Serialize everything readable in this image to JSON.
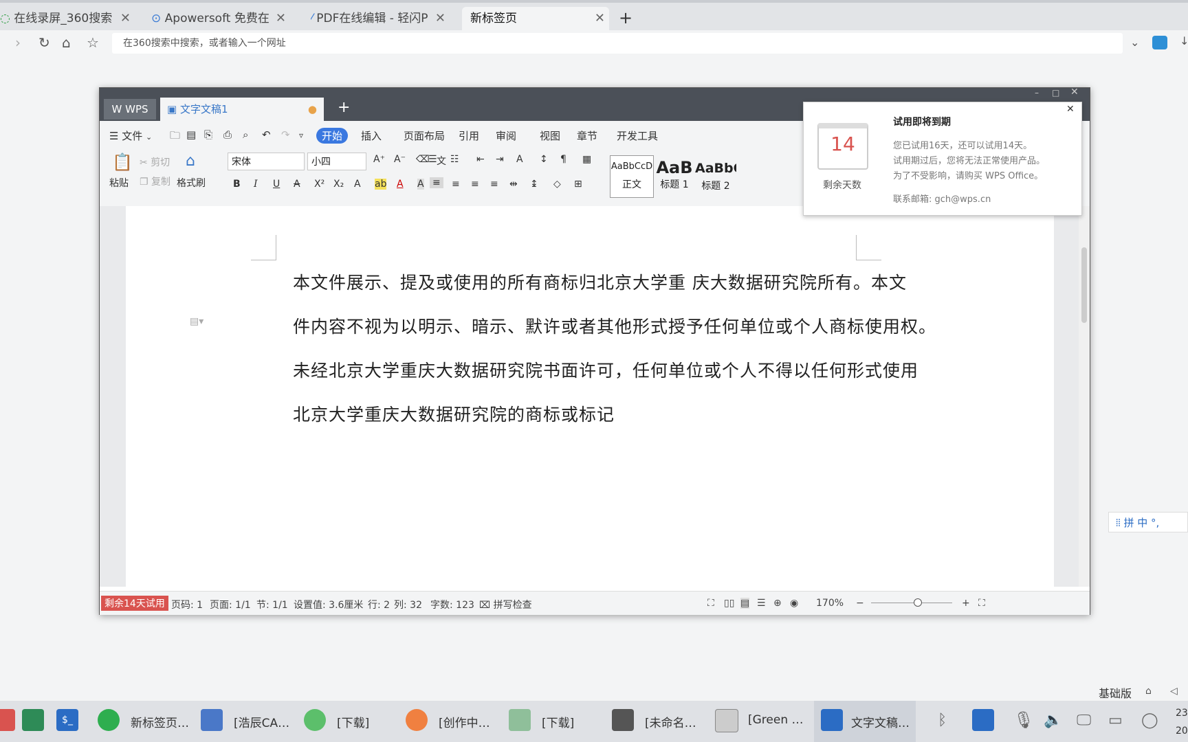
{
  "browser": {
    "tabs": [
      {
        "label": "在线录屏_360搜索"
      },
      {
        "label": "Apowersoft 免费在"
      },
      {
        "label": "PDF在线编辑 - 轻闪P"
      },
      {
        "label": "新标签页"
      }
    ],
    "new_tab": "+",
    "address_placeholder": "在360搜索中搜索，或者输入一个网址"
  },
  "wps": {
    "tab_wps": "WPS",
    "tab_doc": "文字文稿1",
    "add_tab": "+",
    "menu": {
      "file": "文件",
      "items": [
        "开始",
        "插入",
        "页面布局",
        "引用",
        "审阅",
        "视图",
        "章节",
        "开发工具"
      ]
    },
    "ribbon": {
      "paste": "粘贴",
      "cut": "剪切",
      "copy": "复制",
      "format_painter": "格式刷",
      "font_name": "宋体",
      "font_size": "小四",
      "bold": "B",
      "italic": "I",
      "underline": "U",
      "styles": [
        {
          "preview": "AaBbCcD",
          "label": "正文"
        },
        {
          "preview": "AaB",
          "label": "标题 1"
        },
        {
          "preview": "AaBbC",
          "label": "标题 2"
        }
      ]
    },
    "document": {
      "lines": [
        "本文件展示、提及或使用的所有商标归北京大学重 庆大数据研究院所有。本文",
        "件内容不视为以明示、暗示、默许或者其他形式授予任何单位或个人商标使用权。",
        "未经北京大学重庆大数据研究院书面许可，任何单位或个人不得以任何形式使用",
        "北京大学重庆大数据研究院的商标或标记"
      ]
    },
    "status": {
      "trial": "剩余14天试用",
      "page_code": "页码: 1",
      "page": "页面: 1/1",
      "section": "节: 1/1",
      "setting": "设置值: 3.6厘米",
      "row": "行: 2",
      "col": "列: 32",
      "words": "字数: 123",
      "spellcheck": "拼写检查",
      "zoom": "170%"
    },
    "popup": {
      "days": "14",
      "days_label": "剩余天数",
      "title": "试用即将到期",
      "line1": "您已试用16天，还可以试用14天。",
      "line2": "试用期过后，您将无法正常使用产品。",
      "line3": "为了不受影响，请购买 WPS Office。",
      "email": "联系邮箱: gch@wps.cn"
    }
  },
  "ime": {
    "label": "拼 中 °,"
  },
  "desktop": {
    "edition": "基础版"
  },
  "taskbar": {
    "items": [
      {
        "label": "新标签页…"
      },
      {
        "label": "[浩辰CA…"
      },
      {
        "label": "[下载]"
      },
      {
        "label": "[创作中…"
      },
      {
        "label": "[下载]"
      },
      {
        "label": "[未命名…"
      },
      {
        "label": "[Green …"
      },
      {
        "label": "文字文稿…"
      }
    ],
    "clock_top": "23",
    "clock_bottom": "20"
  }
}
